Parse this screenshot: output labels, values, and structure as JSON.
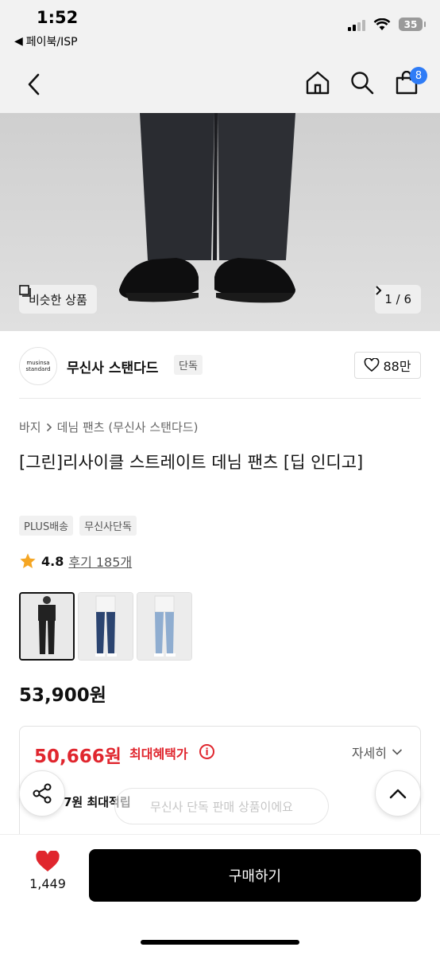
{
  "status_bar": {
    "time": "1:52",
    "back_app": "페이북/ISP",
    "battery": "35",
    "icons": [
      "signal-icon",
      "wifi-icon",
      "battery-icon"
    ]
  },
  "nav": {
    "icons": [
      "back-icon",
      "home-icon",
      "search-icon",
      "cart-icon"
    ],
    "cart_count": "8"
  },
  "gallery": {
    "similar_label": "비슷한 상품",
    "page_indicator": "1 / 6"
  },
  "brand": {
    "logo_line1": "musinsa",
    "logo_line2": "standard",
    "name": "무신사 스탠다드",
    "tag": "단독",
    "likes": "88만"
  },
  "breadcrumb": [
    "바지",
    "데님 팬츠 (무신사 스탠다드)"
  ],
  "product": {
    "title": "[그린]리사이클 스트레이트 데님 팬츠 [딥 인디고]",
    "tags": [
      "PLUS배송",
      "무신사단독"
    ],
    "rating": "4.8",
    "review": "후기 185개",
    "price": "53,900원"
  },
  "color_options": [
    {
      "name": "black",
      "color": "#1f1f1f"
    },
    {
      "name": "deep-indigo",
      "color": "#2b4470"
    },
    {
      "name": "light-blue",
      "color": "#8fadd0"
    }
  ],
  "benefit": {
    "price": "50,666원",
    "label": "최대혜택가",
    "detail": "자세히",
    "points": "7원 최대적립"
  },
  "toast": "무신사 단독 판매 상품이에요",
  "bottom": {
    "likes": "1,449",
    "buy_label": "구매하기"
  },
  "colors": {
    "accent_red": "#e0262e",
    "badge_blue": "#2f7cf6",
    "star": "#f5a623"
  }
}
